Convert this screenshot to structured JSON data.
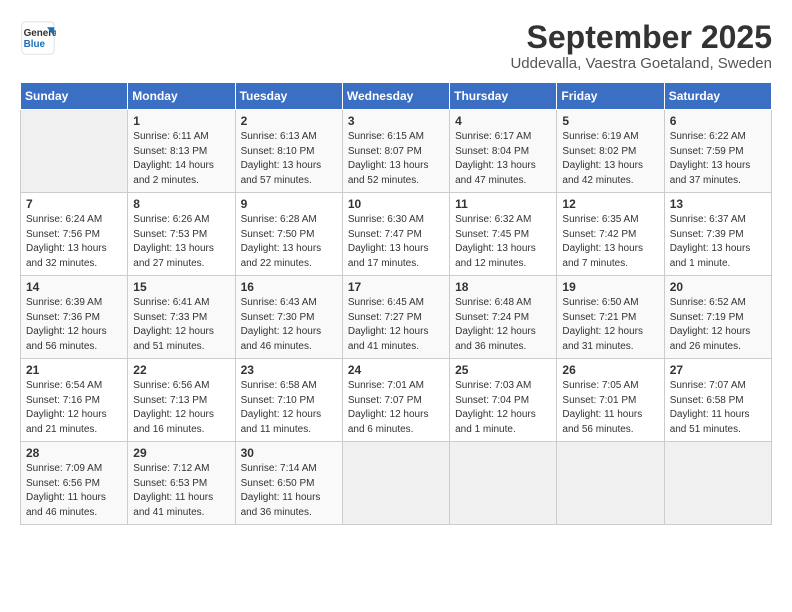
{
  "logo": {
    "line1": "General",
    "line2": "Blue"
  },
  "title": "September 2025",
  "subtitle": "Uddevalla, Vaestra Goetaland, Sweden",
  "weekdays": [
    "Sunday",
    "Monday",
    "Tuesday",
    "Wednesday",
    "Thursday",
    "Friday",
    "Saturday"
  ],
  "weeks": [
    [
      {
        "day": "",
        "info": ""
      },
      {
        "day": "1",
        "info": "Sunrise: 6:11 AM\nSunset: 8:13 PM\nDaylight: 14 hours\nand 2 minutes."
      },
      {
        "day": "2",
        "info": "Sunrise: 6:13 AM\nSunset: 8:10 PM\nDaylight: 13 hours\nand 57 minutes."
      },
      {
        "day": "3",
        "info": "Sunrise: 6:15 AM\nSunset: 8:07 PM\nDaylight: 13 hours\nand 52 minutes."
      },
      {
        "day": "4",
        "info": "Sunrise: 6:17 AM\nSunset: 8:04 PM\nDaylight: 13 hours\nand 47 minutes."
      },
      {
        "day": "5",
        "info": "Sunrise: 6:19 AM\nSunset: 8:02 PM\nDaylight: 13 hours\nand 42 minutes."
      },
      {
        "day": "6",
        "info": "Sunrise: 6:22 AM\nSunset: 7:59 PM\nDaylight: 13 hours\nand 37 minutes."
      }
    ],
    [
      {
        "day": "7",
        "info": "Sunrise: 6:24 AM\nSunset: 7:56 PM\nDaylight: 13 hours\nand 32 minutes."
      },
      {
        "day": "8",
        "info": "Sunrise: 6:26 AM\nSunset: 7:53 PM\nDaylight: 13 hours\nand 27 minutes."
      },
      {
        "day": "9",
        "info": "Sunrise: 6:28 AM\nSunset: 7:50 PM\nDaylight: 13 hours\nand 22 minutes."
      },
      {
        "day": "10",
        "info": "Sunrise: 6:30 AM\nSunset: 7:47 PM\nDaylight: 13 hours\nand 17 minutes."
      },
      {
        "day": "11",
        "info": "Sunrise: 6:32 AM\nSunset: 7:45 PM\nDaylight: 13 hours\nand 12 minutes."
      },
      {
        "day": "12",
        "info": "Sunrise: 6:35 AM\nSunset: 7:42 PM\nDaylight: 13 hours\nand 7 minutes."
      },
      {
        "day": "13",
        "info": "Sunrise: 6:37 AM\nSunset: 7:39 PM\nDaylight: 13 hours\nand 1 minute."
      }
    ],
    [
      {
        "day": "14",
        "info": "Sunrise: 6:39 AM\nSunset: 7:36 PM\nDaylight: 12 hours\nand 56 minutes."
      },
      {
        "day": "15",
        "info": "Sunrise: 6:41 AM\nSunset: 7:33 PM\nDaylight: 12 hours\nand 51 minutes."
      },
      {
        "day": "16",
        "info": "Sunrise: 6:43 AM\nSunset: 7:30 PM\nDaylight: 12 hours\nand 46 minutes."
      },
      {
        "day": "17",
        "info": "Sunrise: 6:45 AM\nSunset: 7:27 PM\nDaylight: 12 hours\nand 41 minutes."
      },
      {
        "day": "18",
        "info": "Sunrise: 6:48 AM\nSunset: 7:24 PM\nDaylight: 12 hours\nand 36 minutes."
      },
      {
        "day": "19",
        "info": "Sunrise: 6:50 AM\nSunset: 7:21 PM\nDaylight: 12 hours\nand 31 minutes."
      },
      {
        "day": "20",
        "info": "Sunrise: 6:52 AM\nSunset: 7:19 PM\nDaylight: 12 hours\nand 26 minutes."
      }
    ],
    [
      {
        "day": "21",
        "info": "Sunrise: 6:54 AM\nSunset: 7:16 PM\nDaylight: 12 hours\nand 21 minutes."
      },
      {
        "day": "22",
        "info": "Sunrise: 6:56 AM\nSunset: 7:13 PM\nDaylight: 12 hours\nand 16 minutes."
      },
      {
        "day": "23",
        "info": "Sunrise: 6:58 AM\nSunset: 7:10 PM\nDaylight: 12 hours\nand 11 minutes."
      },
      {
        "day": "24",
        "info": "Sunrise: 7:01 AM\nSunset: 7:07 PM\nDaylight: 12 hours\nand 6 minutes."
      },
      {
        "day": "25",
        "info": "Sunrise: 7:03 AM\nSunset: 7:04 PM\nDaylight: 12 hours\nand 1 minute."
      },
      {
        "day": "26",
        "info": "Sunrise: 7:05 AM\nSunset: 7:01 PM\nDaylight: 11 hours\nand 56 minutes."
      },
      {
        "day": "27",
        "info": "Sunrise: 7:07 AM\nSunset: 6:58 PM\nDaylight: 11 hours\nand 51 minutes."
      }
    ],
    [
      {
        "day": "28",
        "info": "Sunrise: 7:09 AM\nSunset: 6:56 PM\nDaylight: 11 hours\nand 46 minutes."
      },
      {
        "day": "29",
        "info": "Sunrise: 7:12 AM\nSunset: 6:53 PM\nDaylight: 11 hours\nand 41 minutes."
      },
      {
        "day": "30",
        "info": "Sunrise: 7:14 AM\nSunset: 6:50 PM\nDaylight: 11 hours\nand 36 minutes."
      },
      {
        "day": "",
        "info": ""
      },
      {
        "day": "",
        "info": ""
      },
      {
        "day": "",
        "info": ""
      },
      {
        "day": "",
        "info": ""
      }
    ]
  ]
}
